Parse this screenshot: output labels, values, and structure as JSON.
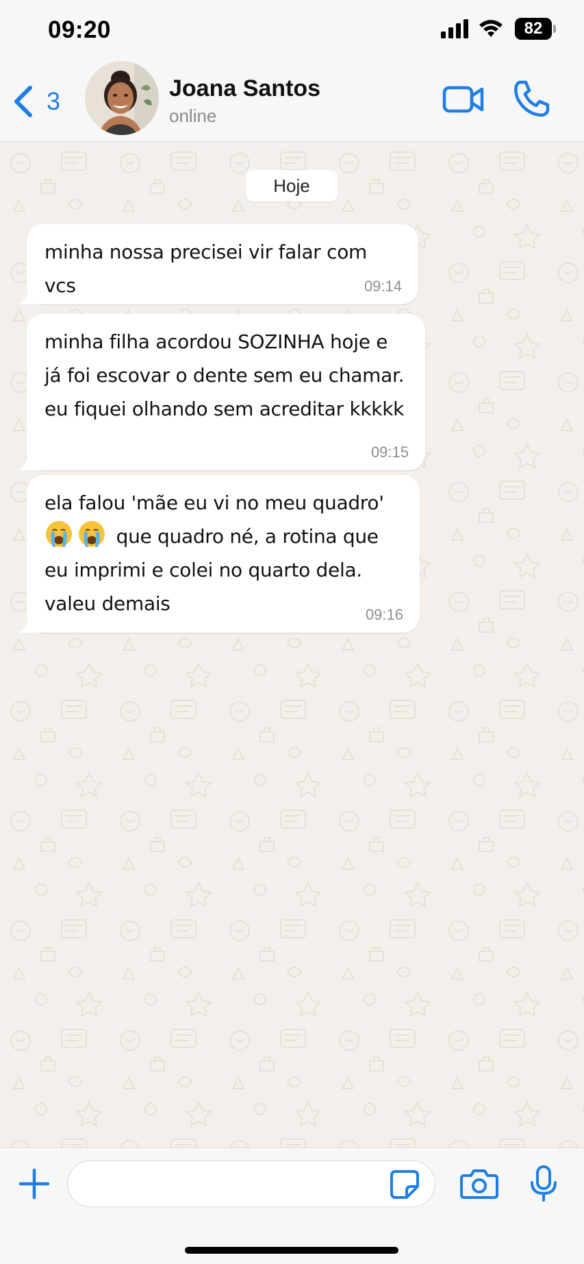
{
  "status_bar": {
    "time": "09:20",
    "battery": "82"
  },
  "header": {
    "back_count": "3",
    "contact_name": "Joana Santos",
    "contact_status": "online"
  },
  "chat": {
    "date_label": "Hoje",
    "messages": [
      {
        "text": "minha nossa precisei vir falar com vcs",
        "time": "09:14"
      },
      {
        "text": "minha filha acordou SOZINHA hoje e\njá foi escovar o dente sem eu chamar.\neu fiquei olhando sem acreditar kkkkk",
        "time": "09:15"
      },
      {
        "line1": "ela falou 'mãe eu vi no meu quadro'",
        "line2": "que quadro né, a rotina que",
        "line3": "eu imprimi e colei no quarto dela.",
        "line4": "valeu demais",
        "emoji": "😭😭",
        "time": "09:16"
      }
    ]
  },
  "input": {
    "value": "",
    "placeholder": ""
  },
  "colors": {
    "accent": "#1e7ee8",
    "bubble": "#ffffff",
    "wallpaper": "#f4efea",
    "bar": "#f7f7f7"
  },
  "icons": [
    "back-chevron-icon",
    "video-call-icon",
    "phone-call-icon",
    "plus-icon",
    "sticker-icon",
    "camera-icon",
    "microphone-icon",
    "signal-icon",
    "wifi-icon",
    "battery-icon",
    "crying-face-emoji"
  ]
}
